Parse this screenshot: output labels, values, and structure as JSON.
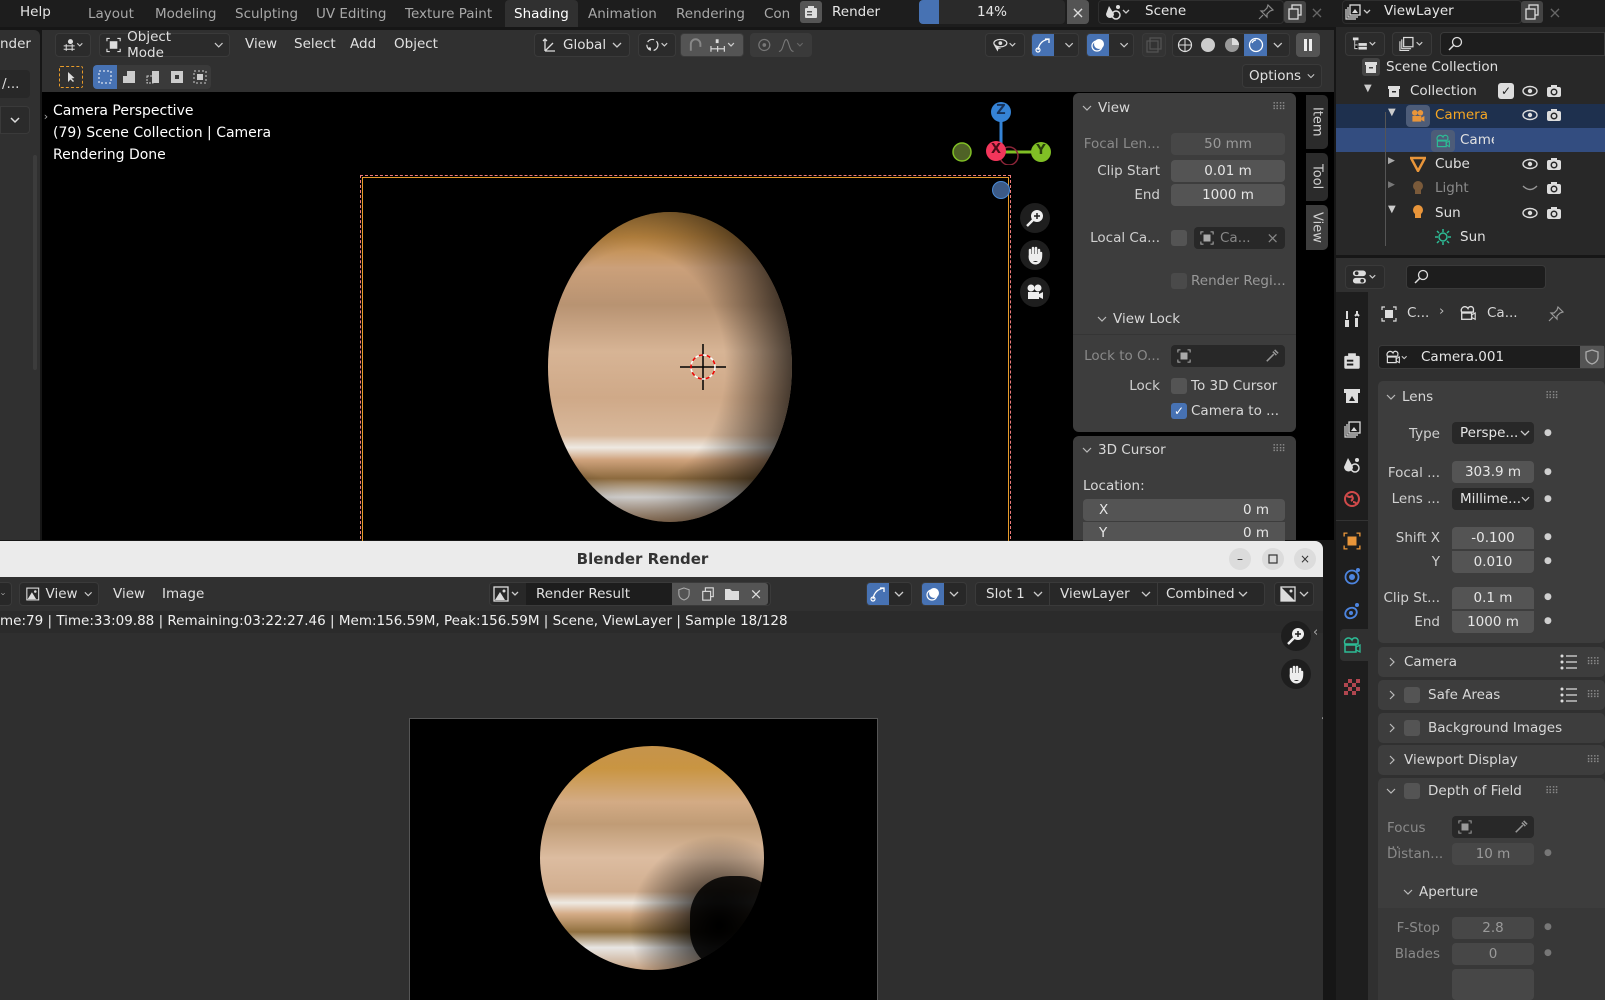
{
  "topbar": {
    "menu_help": "Help",
    "workspace_tabs": [
      "Layout",
      "Modeling",
      "Sculpting",
      "UV Editing",
      "Texture Paint",
      "Shading",
      "Animation",
      "Rendering",
      "Con"
    ],
    "active_tab": "Shading",
    "render_label": "Render",
    "progress_text": "14%",
    "progress_value": 0.14,
    "scene_name": "Scene",
    "view_layer_name": "ViewLayer"
  },
  "left_strip": {
    "label_partial": "nder",
    "field_partial": "/..."
  },
  "viewport": {
    "header": {
      "mode": "Object Mode",
      "menus": [
        "View",
        "Select",
        "Add",
        "Object"
      ],
      "orientation": "Global",
      "options_label": "Options"
    },
    "overlay": {
      "line1": "Camera Perspective",
      "line2": "(79) Scene Collection | Camera",
      "line3": "Rendering Done"
    },
    "gizmo": {
      "z": "Z",
      "x": "X",
      "y": "Y"
    },
    "side_tabs": [
      "Item",
      "Tool",
      "View"
    ],
    "active_side_tab": "View"
  },
  "npanel": {
    "view": {
      "title": "View",
      "focal_length_label": "Focal Len...",
      "focal_length_value": "50 mm",
      "clip_start_label": "Clip Start",
      "clip_start_value": "0.01 m",
      "clip_end_label": "End",
      "clip_end_value": "1000 m",
      "local_camera_label": "Local Ca...",
      "local_camera_value": "Ca...",
      "render_region_label": "Render Regi..."
    },
    "view_lock": {
      "title": "View Lock",
      "lock_to_object_label": "Lock to O...",
      "lock_label": "Lock",
      "to_3d_cursor_label": "To 3D Cursor",
      "to_3d_cursor_checked": false,
      "camera_to_view_label": "Camera to ...",
      "camera_to_view_checked": true
    },
    "cursor": {
      "title": "3D Cursor",
      "location_label": "Location:",
      "x_label": "X",
      "x_value": "0 m",
      "y_label": "Y",
      "y_value": "0 m"
    }
  },
  "outliner": {
    "root": "Scene Collection",
    "items": [
      {
        "name": "Collection",
        "color": "#e0e0e0"
      },
      {
        "name": "Camera",
        "color": "#f5a623"
      },
      {
        "name": "Came",
        "color": "#e0e0e0"
      },
      {
        "name": "Cube",
        "color": "#e0e0e0"
      },
      {
        "name": "Light",
        "color": "#8a8a8a"
      },
      {
        "name": "Sun",
        "color": "#e0e0e0"
      },
      {
        "name": "Sun",
        "color": "#e0e0e0"
      }
    ]
  },
  "properties": {
    "breadcrumb_object": "C...",
    "breadcrumb_data": "Ca...",
    "datablock_name": "Camera.001",
    "lens": {
      "title": "Lens",
      "type_label": "Type",
      "type_value": "Perspe...",
      "focal_label": "Focal ...",
      "focal_value": "303.9 m",
      "lens_unit_label": "Lens ...",
      "lens_unit_value": "Millime...",
      "shift_x_label": "Shift X",
      "shift_x_value": "-0.100",
      "shift_y_label": "Y",
      "shift_y_value": "0.010",
      "clip_start_label": "Clip St...",
      "clip_start_value": "0.1 m",
      "clip_end_label": "End",
      "clip_end_value": "1000 m"
    },
    "sections": [
      "Camera",
      "Safe Areas",
      "Background Images",
      "Viewport Display"
    ],
    "dof": {
      "title": "Depth of Field",
      "focus_label": "Focus ...",
      "distance_label": "Distan...",
      "distance_value": "10 m",
      "aperture_title": "Aperture",
      "fstop_label": "F-Stop",
      "fstop_value": "2.8",
      "blades_label": "Blades",
      "blades_value": "0"
    }
  },
  "render_window": {
    "title": "Blender Render",
    "view_dropdown": "View",
    "menus": [
      "View",
      "Image"
    ],
    "image_name": "Render Result",
    "slot": "Slot 1",
    "view_layer": "ViewLayer",
    "pass": "Combined",
    "status": "me:79 | Time:33:09.88 | Remaining:03:22:27.46 | Mem:156.59M, Peak:156.59M | Scene, ViewLayer | Sample 18/128"
  },
  "colors": {
    "accent_blue": "#4772b3",
    "gizmo_x": "#f2365b",
    "gizmo_y": "#80bf25",
    "gizmo_z": "#3583d6",
    "camera_orange": "#f5a623",
    "data_teal": "#2dbb95"
  }
}
